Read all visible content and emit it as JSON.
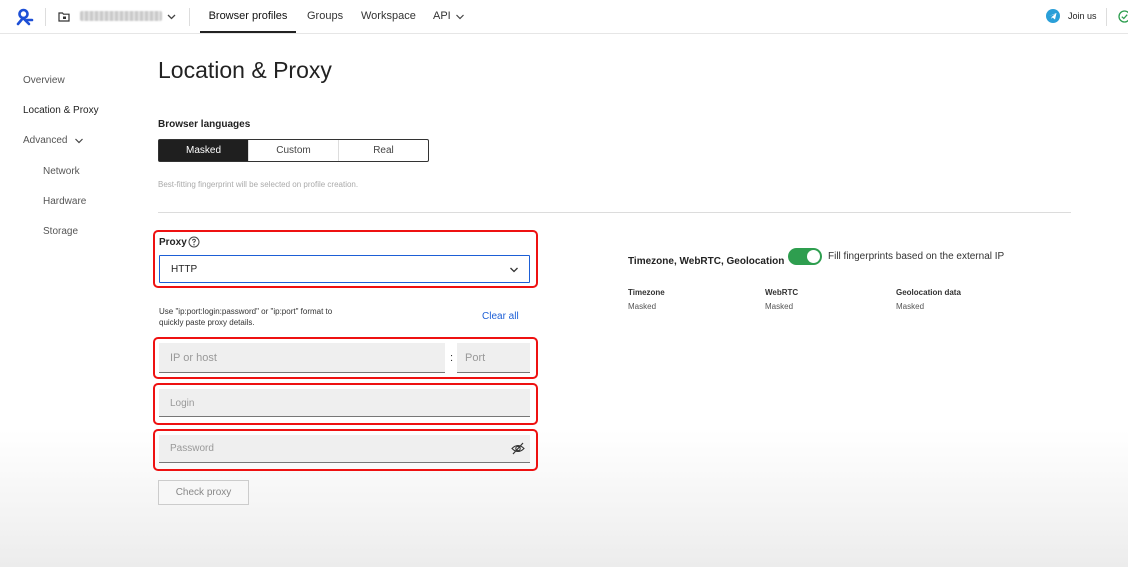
{
  "topbar": {
    "tabs": [
      "Browser profiles",
      "Groups",
      "Workspace",
      "API"
    ],
    "join_label": "Join us",
    "icons": [
      "logo-icon",
      "folder-icon",
      "chevron-down-icon",
      "telegram-icon",
      "check-circle-icon"
    ]
  },
  "sidebar": {
    "items": [
      "Overview",
      "Location & Proxy",
      "Advanced",
      "Network",
      "Hardware",
      "Storage"
    ],
    "active": "Location & Proxy"
  },
  "main": {
    "title": "Location & Proxy",
    "browser_languages": {
      "label": "Browser languages",
      "options": [
        "Masked",
        "Custom",
        "Real"
      ],
      "selected": "Masked",
      "hint": "Best-fitting fingerprint will be selected on profile creation."
    },
    "proxy": {
      "label": "Proxy",
      "type_value": "HTTP",
      "paste_hint": "Use \"ip:port:login:password\" or \"ip:port\" format to quickly paste proxy details.",
      "clear_all": "Clear all",
      "ip_placeholder": "IP or host",
      "colon": ":",
      "port_placeholder": "Port",
      "login_placeholder": "Login",
      "password_placeholder": "Password",
      "check_button": "Check proxy"
    }
  },
  "right_panel": {
    "title": "Timezone, WebRTC, Geolocation",
    "toggle_label": "Fill fingerprints based on the external IP",
    "toggle_on": true,
    "columns": [
      {
        "header": "Timezone",
        "value": "Masked"
      },
      {
        "header": "WebRTC",
        "value": "Masked"
      },
      {
        "header": "Geolocation data",
        "value": "Masked"
      }
    ]
  },
  "colors": {
    "accent_blue": "#1d5fd6",
    "toggle_green": "#2e9e4f",
    "highlight_red": "#e11111"
  }
}
